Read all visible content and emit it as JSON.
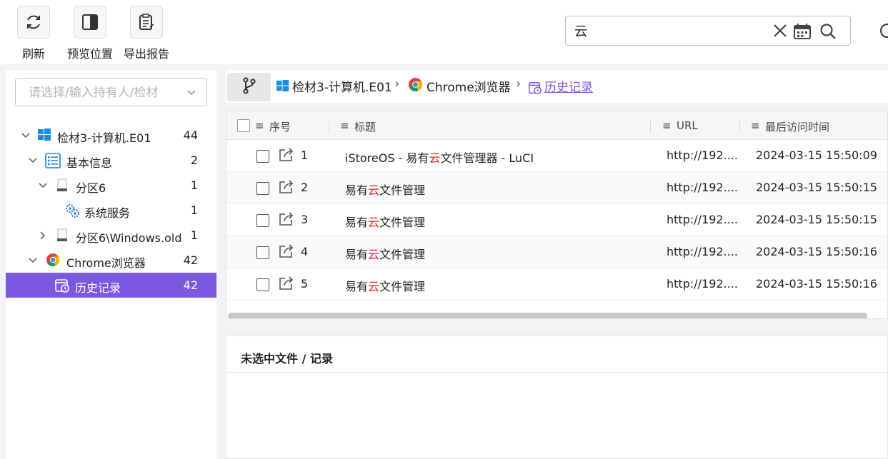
{
  "toolbar": {
    "refresh_label": "刷新",
    "preview_label": "预览位置",
    "export_label": "导出报告"
  },
  "search": {
    "value": "云",
    "icons": [
      "clear-icon",
      "calendar-icon",
      "search-icon"
    ]
  },
  "sidebar": {
    "owner_placeholder": "请选择/输入持有人/检材",
    "tree": [
      {
        "label": "检材3-计算机.E01",
        "count": "44",
        "icon": "windows-icon",
        "expanded": true
      },
      {
        "label": "基本信息",
        "count": "2",
        "icon": "info-list-icon",
        "expanded": true
      },
      {
        "label": "分区6",
        "count": "1",
        "icon": "drive-icon",
        "expanded": true
      },
      {
        "label": "系统服务",
        "count": "1",
        "icon": "gear-cluster-icon"
      },
      {
        "label": "分区6\\Windows.old",
        "count": "1",
        "icon": "drive-icon",
        "expanded": false
      },
      {
        "label": "Chrome浏览器",
        "count": "42",
        "icon": "chrome-icon",
        "expanded": true
      },
      {
        "label": "历史记录",
        "count": "42",
        "icon": "history-icon",
        "selected": true
      }
    ]
  },
  "breadcrumb": {
    "items": [
      "检材3-计算机.E01",
      "Chrome浏览器",
      "历史记录"
    ]
  },
  "table": {
    "columns": [
      "序号",
      "标题",
      "URL",
      "最后访问时间"
    ],
    "rows": [
      {
        "index": "1",
        "title_pre": "iStoreOS - 易有",
        "title_hl": "云",
        "title_post": "文件管理器 - LuCI",
        "url": "http://192....",
        "time": "2024-03-15 15:50:09"
      },
      {
        "index": "2",
        "title_pre": "易有",
        "title_hl": "云",
        "title_post": "文件管理",
        "url": "http://192....",
        "time": "2024-03-15 15:50:15"
      },
      {
        "index": "3",
        "title_pre": "易有",
        "title_hl": "云",
        "title_post": "文件管理",
        "url": "http://192....",
        "time": "2024-03-15 15:50:15"
      },
      {
        "index": "4",
        "title_pre": "易有",
        "title_hl": "云",
        "title_post": "文件管理",
        "url": "http://192....",
        "time": "2024-03-15 15:50:16"
      },
      {
        "index": "5",
        "title_pre": "易有",
        "title_hl": "云",
        "title_post": "文件管理",
        "url": "http://192....",
        "time": "2024-03-15 15:50:16"
      }
    ]
  },
  "detail": {
    "title": "未选中文件 / 记录"
  },
  "colors": {
    "accent": "#7c57e0",
    "highlight": "#e02020"
  }
}
